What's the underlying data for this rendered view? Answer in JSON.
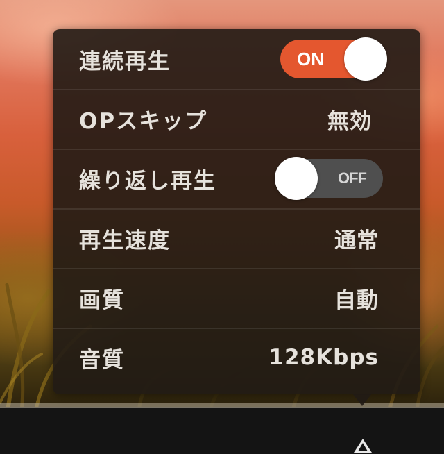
{
  "settings": {
    "continuous_play": {
      "label": "連続再生",
      "toggle_text": "ON",
      "enabled": true
    },
    "op_skip": {
      "label": "OPスキップ",
      "value": "無効"
    },
    "repeat_play": {
      "label": "繰り返し再生",
      "toggle_text": "OFF",
      "enabled": false
    },
    "playback_speed": {
      "label": "再生速度",
      "value": "通常"
    },
    "video_quality": {
      "label": "画質",
      "value": "自動"
    },
    "audio_quality": {
      "label": "音質",
      "value": "128Kbps"
    }
  },
  "colors": {
    "toggle_on": "#e4572f",
    "toggle_off": "#4f4f4f",
    "panel_bg": "#211b15",
    "text": "#e6e2dc"
  },
  "icons": {
    "bottom_control": "settings-triangle-icon"
  }
}
